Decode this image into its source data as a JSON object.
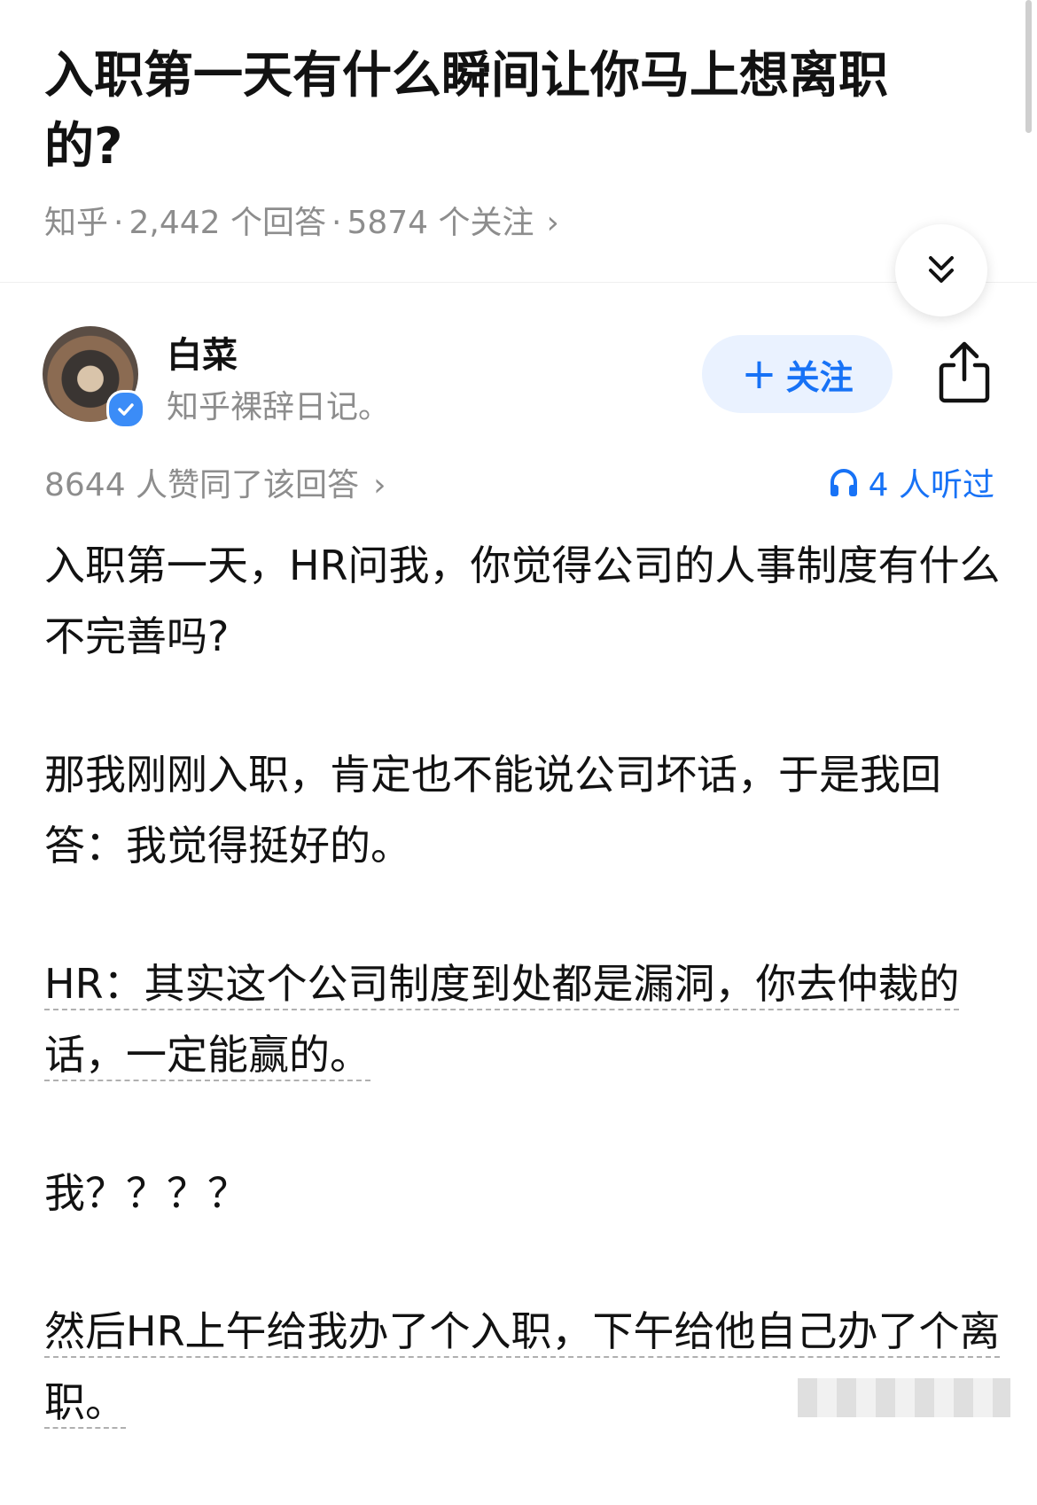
{
  "question": {
    "title": "入职第一天有什么瞬间让你马上想离职的?",
    "source": "知乎",
    "answer_count": "2,442 个回答",
    "follow_count": "5874 个关注",
    "meta_chevron": "›"
  },
  "author": {
    "name": "白菜",
    "bio": "知乎裸辞日记。",
    "follow_label": "关注",
    "follow_icon": "+"
  },
  "answer": {
    "upvotes": "8644 人赞同了该回答",
    "upvotes_chevron": "›",
    "listened": "4 人听过",
    "paragraphs": [
      "入职第一天，HR问我，你觉得公司的人事制度有什么不完善吗?",
      "那我刚刚入职，肯定也不能说公司坏话，于是我回答：我觉得挺好的。",
      "HR：其实这个公司制度到处都是漏洞，你去仲裁的话，一定能赢的。",
      "我？？？？",
      "然后HR上午给我办了个入职，下午给他自己办了个离职。"
    ]
  },
  "icons": {
    "collapse": "double-chevron-down-icon",
    "share": "share-icon",
    "verified": "verified-badge-icon",
    "headphones": "headphones-icon"
  },
  "colors": {
    "accent": "#1772f6",
    "follow_bg": "#eaf2ff",
    "meta": "#8d8d8d",
    "text": "#121212"
  }
}
